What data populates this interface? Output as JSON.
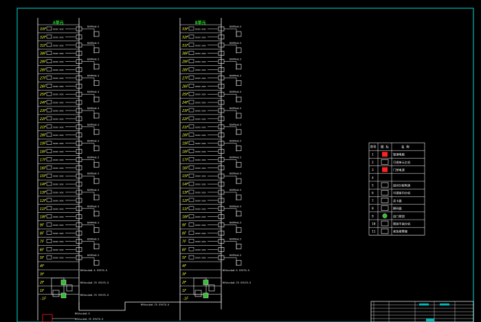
{
  "title": "",
  "riser_left": {
    "header": "A单元",
    "floors": [
      "33F",
      "32F",
      "31F",
      "30F",
      "29F",
      "28F",
      "27F",
      "26F",
      "25F",
      "24F",
      "23F",
      "22F",
      "21F",
      "20F",
      "19F",
      "18F",
      "17F",
      "16F",
      "15F",
      "14F",
      "13F",
      "12F",
      "11F",
      "10F",
      "9F",
      "8F",
      "7F",
      "6F",
      "5F",
      "4F",
      "3F",
      "2F",
      "1F",
      "-1F"
    ],
    "device_label": "RVVP4×0.5",
    "device_caption": "XXXXX XXXX",
    "trunk_labels": [
      "RVVsc4x0.5  SYV75-5",
      "RVVsc4x0.75  SYV75-5",
      "RVVsc4x0.75  SYV75-5"
    ],
    "trunk_label_dup": "RVVsc4x0.75  SYV75-5"
  },
  "riser_right": {
    "header": "B单元",
    "floors": [
      "33F",
      "32F",
      "31F",
      "30F",
      "29F",
      "28F",
      "27F",
      "26F",
      "25F",
      "24F",
      "23F",
      "22F",
      "21F",
      "20F",
      "19F",
      "18F",
      "17F",
      "16F",
      "15F",
      "14F",
      "13F",
      "12F",
      "11F",
      "10F",
      "9F",
      "8F",
      "7F",
      "6F",
      "5F",
      "4F",
      "3F",
      "2F",
      "1F",
      "-1F"
    ],
    "device_label": "RVVP4×0.5",
    "device_caption": "XXXXX XXXX",
    "trunk_labels": [
      "RVVsc4x0.5  SYV75-5",
      "RVVsc4x0.75  SYV75-5"
    ]
  },
  "bus_labels": [
    "RVVsc4x0.75  SYV75-5",
    "RVVsc4x0.75  SYV75-5",
    "RVVsc4x0.5"
  ],
  "legend": {
    "headers": [
      "序号",
      "图 标",
      "名 称"
    ],
    "rows": [
      {
        "no": "1",
        "name": "管理电脑",
        "icon": "red-block"
      },
      {
        "no": "2",
        "name": "可视单元主机",
        "icon": "panel"
      },
      {
        "no": "3",
        "name": "门禁电源",
        "icon": "red-square"
      },
      {
        "no": "4",
        "name": "",
        "icon": "none"
      },
      {
        "no": "5",
        "name": "层间分配电源",
        "icon": "box"
      },
      {
        "no": "6",
        "name": "可视室内分机",
        "icon": "monitor"
      },
      {
        "no": "7",
        "name": "读卡器",
        "icon": "reader"
      },
      {
        "no": "8",
        "name": "解码器",
        "icon": "decoder"
      },
      {
        "no": "9",
        "name": "出门按钮",
        "icon": "green-button"
      },
      {
        "no": "10",
        "name": "楼层平面分机",
        "icon": "panel2"
      },
      {
        "no": "11",
        "name": "紧急报警器",
        "icon": "alarm"
      }
    ]
  },
  "title_block": {
    "rows": [
      "",
      "",
      "",
      "",
      "",
      ""
    ]
  },
  "colors": {
    "background": "#000000",
    "frame": "#00b8b8",
    "line": "#ffffff",
    "text_green": "#20e020",
    "text_yellow": "#ffff40",
    "accent_red": "#ff2020"
  }
}
